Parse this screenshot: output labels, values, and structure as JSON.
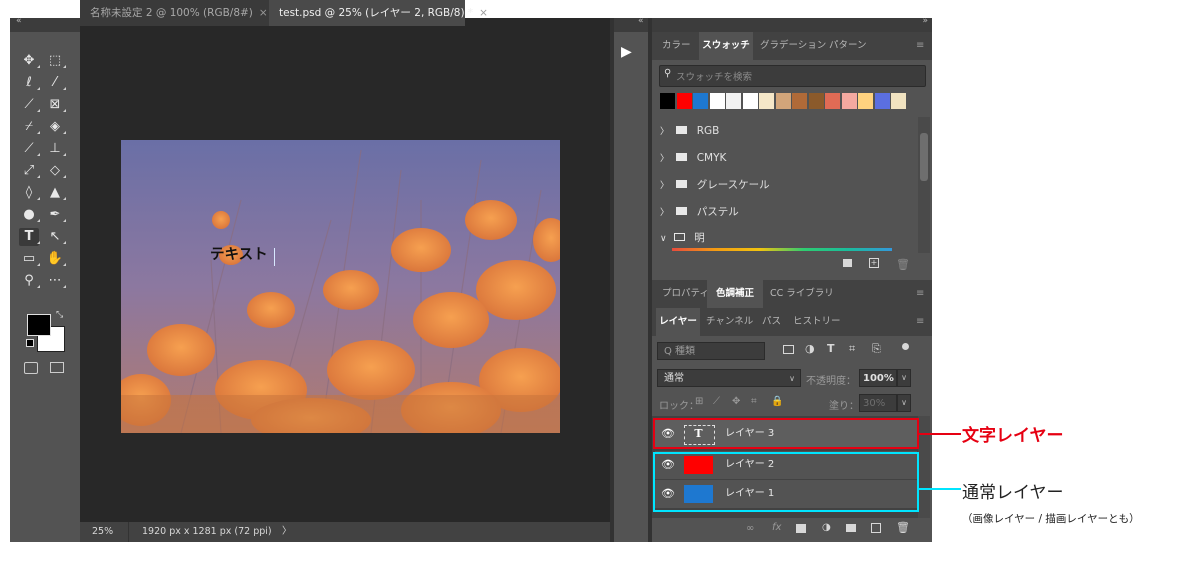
{
  "document_tabs": [
    {
      "label": "名称未設定 2 @ 100% (RGB/8#)",
      "close": "×"
    },
    {
      "label": "test.psd @ 25% (レイヤー 2, RGB/8) *",
      "close": "×"
    }
  ],
  "canvas_text": "テキスト",
  "status_bar": {
    "zoom": "25%",
    "info": "1920 px x 1281 px (72 ppi)",
    "arrow": "〉"
  },
  "swatches_panel": {
    "tabs": [
      "カラー",
      "スウォッチ",
      "グラデーション",
      "パターン"
    ],
    "active_tab": "スウォッチ",
    "search_placeholder": "スウォッチを検索",
    "recent_colors": [
      "#000000",
      "#ff0000",
      "#1e78d0",
      "#ffffff",
      "#f2f2f2",
      "#ffffff",
      "#f5e7c8",
      "#d2a57a",
      "#b06a38",
      "#8b5a2b",
      "#e06b55",
      "#f4a9a0",
      "#ffd27f",
      "#5b6fe0",
      "#f0e2c0"
    ],
    "folders": [
      {
        "chevron": "〉",
        "name": "RGB"
      },
      {
        "chevron": "〉",
        "name": "CMYK"
      },
      {
        "chevron": "〉",
        "name": "グレースケール"
      },
      {
        "chevron": "〉",
        "name": "パステル"
      },
      {
        "chevron": "∨",
        "name": "明"
      }
    ]
  },
  "adjust_panel": {
    "tabs": [
      "プロパティ",
      "色調補正",
      "CC ライブラリ"
    ],
    "active_tab": "色調補正"
  },
  "layers_panel": {
    "tabs": [
      "レイヤー",
      "チャンネル",
      "パス",
      "ヒストリー"
    ],
    "active_tab": "レイヤー",
    "filter_placeholder": "Q 種類",
    "blend_mode": "通常",
    "opacity_label": "不透明度：",
    "opacity_value": "100%",
    "lock_label": "ロック：",
    "fill_label": "塗り：",
    "fill_value": "30%",
    "layers": [
      {
        "name": "レイヤー 3",
        "thumb": "T",
        "type": "text"
      },
      {
        "name": "レイヤー 2",
        "thumb_color": "#ff0000",
        "type": "normal"
      },
      {
        "name": "レイヤー 1",
        "thumb_color": "#1e78d0",
        "type": "normal"
      }
    ],
    "footer_icons": [
      "link-icon",
      "fx-icon",
      "mask-icon",
      "adjustment-icon",
      "folder-icon",
      "new-layer-icon",
      "trash-icon"
    ],
    "fx_label": "fx"
  },
  "annotations": {
    "text_layer": {
      "label": "文字レイヤー",
      "color": "#e60012"
    },
    "normal_layer": {
      "label": "通常レイヤー",
      "sub": "（画像レイヤー / 描画レイヤーとも）",
      "color": "#00e5ff"
    }
  },
  "colors": {
    "foreground": "#000000",
    "background": "#ffffff"
  }
}
